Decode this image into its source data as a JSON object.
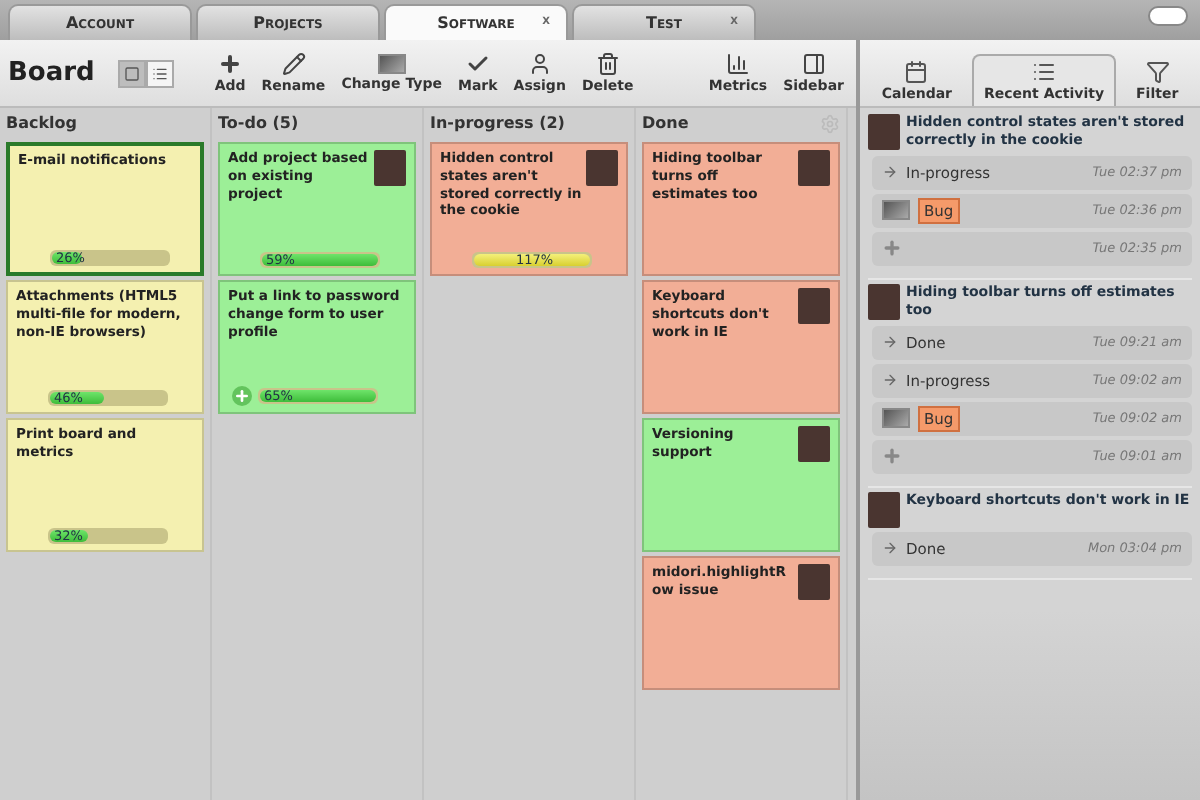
{
  "top_tabs": [
    {
      "label": "Account",
      "selected": false
    },
    {
      "label": "Projects",
      "selected": false
    },
    {
      "label": "Software",
      "selected": true,
      "close": "x"
    },
    {
      "label": "Test",
      "selected": false,
      "close": "x"
    }
  ],
  "toolbar": {
    "title": "Board",
    "view_modes": [
      {
        "kind": "board",
        "selected": true
      },
      {
        "kind": "list",
        "selected": false
      }
    ],
    "buttons": [
      {
        "kind": "add",
        "label": "Add"
      },
      {
        "kind": "rename",
        "label": "Rename"
      },
      {
        "kind": "type",
        "label": "Change Type"
      },
      {
        "kind": "mark",
        "label": "Mark"
      },
      {
        "kind": "assign",
        "label": "Assign"
      },
      {
        "kind": "delete",
        "label": "Delete"
      },
      {
        "kind": "metrics",
        "label": "Metrics"
      },
      {
        "kind": "sidebar",
        "label": "Sidebar"
      }
    ]
  },
  "columns": [
    {
      "title": "Backlog",
      "settings": false,
      "cards": [
        {
          "title": "E-mail notifications",
          "color": "#f4f0b0",
          "selected": true,
          "avatar": false,
          "add_button": false,
          "progress": {
            "label": "26%",
            "level": 0.26,
            "over": false
          }
        },
        {
          "title": "Attachments (HTML5 multi-file for modern, non-IE browsers)",
          "color": "#f4f0b0",
          "selected": false,
          "avatar": false,
          "add_button": false,
          "progress": {
            "label": "46%",
            "level": 0.46,
            "over": false
          }
        },
        {
          "title": "Print board and metrics",
          "color": "#f4f0b0",
          "selected": false,
          "avatar": false,
          "add_button": false,
          "progress": {
            "label": "32%",
            "level": 0.32,
            "over": false
          }
        }
      ]
    },
    {
      "title": "To-do (5)",
      "settings": false,
      "cards": [
        {
          "title": "Add project based on existing project",
          "color": "#9cef97",
          "selected": false,
          "avatar": true,
          "add_button": false,
          "progress": {
            "label": "59%",
            "level": 1,
            "over": false
          }
        },
        {
          "title": "Put a link to password change form to user profile",
          "color": "#9cef97",
          "selected": false,
          "avatar": false,
          "add_button": true,
          "progress": {
            "label": "65%",
            "level": 1,
            "over": false
          }
        }
      ]
    },
    {
      "title": "In-progress (2)",
      "settings": false,
      "cards": [
        {
          "title": "Hidden control states aren't stored correctly in the cookie",
          "color": "#f2ae96",
          "selected": false,
          "avatar": true,
          "add_button": false,
          "progress": {
            "label": "117%",
            "level": 1,
            "over": true
          }
        }
      ]
    },
    {
      "title": "Done",
      "settings": true,
      "cards": [
        {
          "title": "Hiding toolbar turns off estimates too",
          "color": "#f2ae96",
          "selected": false,
          "avatar": true,
          "add_button": false
        },
        {
          "title": "Keyboard shortcuts don't work in IE",
          "color": "#f2ae96",
          "selected": false,
          "avatar": true,
          "add_button": false
        },
        {
          "title": "Versioning support",
          "color": "#9cef97",
          "selected": false,
          "avatar": true,
          "add_button": false
        },
        {
          "title": "midori.highlightRow issue",
          "color": "#f2ae96",
          "selected": false,
          "avatar": true,
          "add_button": false
        }
      ]
    }
  ],
  "sidebar": {
    "tabs": [
      {
        "kind": "calendar",
        "label": "Calendar",
        "selected": false
      },
      {
        "kind": "activity",
        "label": "Recent Activity",
        "selected": true
      },
      {
        "kind": "filter",
        "label": "Filter",
        "selected": false
      }
    ],
    "groups": [
      {
        "title": "Hidden control states aren't stored correctly in the cookie",
        "entries": [
          {
            "kind": "status",
            "text": "In-progress",
            "time": "Tue 02:37 pm"
          },
          {
            "kind": "type",
            "text": "Bug",
            "time": "Tue 02:36 pm"
          },
          {
            "kind": "created",
            "time": "Tue 02:35 pm"
          }
        ]
      },
      {
        "title": "Hiding toolbar turns off estimates too",
        "entries": [
          {
            "kind": "status",
            "text": "Done",
            "time": "Tue 09:21 am"
          },
          {
            "kind": "status",
            "text": "In-progress",
            "time": "Tue 09:02 am"
          },
          {
            "kind": "type",
            "text": "Bug",
            "time": "Tue 09:02 am"
          },
          {
            "kind": "created",
            "time": "Tue 09:01 am"
          }
        ]
      },
      {
        "title": "Keyboard shortcuts don't work in IE",
        "entries": [
          {
            "kind": "status",
            "text": "Done",
            "time": "Mon 03:04 pm"
          }
        ]
      }
    ]
  }
}
